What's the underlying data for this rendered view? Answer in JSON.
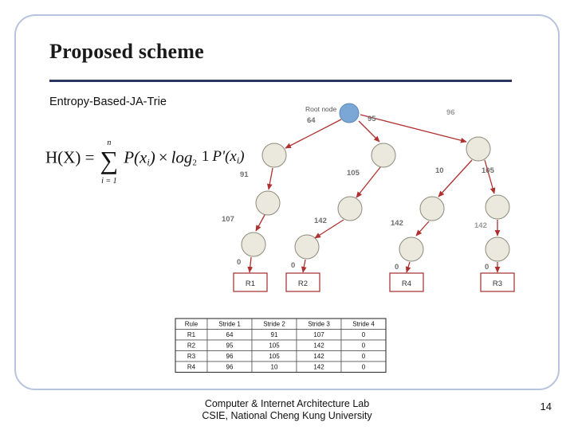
{
  "slide": {
    "title": "Proposed scheme",
    "subtitle": "Entropy-Based-JA-Trie",
    "page_number": "14"
  },
  "formula": {
    "lhs": "H(X) =",
    "sum_upper": "n",
    "sum_lower": "i = 1",
    "sum_symbol": "∑",
    "term": "P(x",
    "term_sub": "i",
    "term_close": ")",
    "times": "×",
    "log": "log",
    "log_base": "2",
    "frac_numerator": "1",
    "frac_denominator": "P'(x",
    "frac_denominator_sub": "i",
    "frac_denominator_close": ")"
  },
  "figure": {
    "root_label": "Root node",
    "edge_labels": {
      "root_left": "64",
      "root_mid": "95",
      "root_right": "96",
      "l1_left": "91",
      "l1_mid": "105",
      "l1_right_a": "10",
      "l1_right_b": "105",
      "l2_left": "107",
      "l2_mid": "142",
      "l2_right_a": "142",
      "l2_right_b": "142",
      "l3_left": "0",
      "l3_mid": "0",
      "l3_right_a": "0",
      "l3_right_b": "0"
    },
    "rule_boxes": [
      "R1",
      "R2",
      "R4",
      "R3"
    ]
  },
  "table": {
    "headers": [
      "Rule",
      "Stride 1",
      "Stride 2",
      "Stride 3",
      "Stride 4"
    ],
    "rows": [
      [
        "R1",
        "64",
        "91",
        "107",
        "0"
      ],
      [
        "R2",
        "95",
        "105",
        "142",
        "0"
      ],
      [
        "R3",
        "96",
        "105",
        "142",
        "0"
      ],
      [
        "R4",
        "96",
        "10",
        "142",
        "0"
      ]
    ]
  },
  "footer": {
    "line1": "Computer & Internet Architecture Lab",
    "line2": "CSIE, National Cheng Kung University"
  },
  "colors": {
    "frame": "#b8c4de",
    "rule": "#2a3560",
    "node_fill": "#ebe9de",
    "node_stroke": "#8c8a7a",
    "root_fill": "#7ba7d7",
    "arrow": "#b03030",
    "box_stroke": "#a02b2b",
    "label_text": "#7a7a7a"
  }
}
